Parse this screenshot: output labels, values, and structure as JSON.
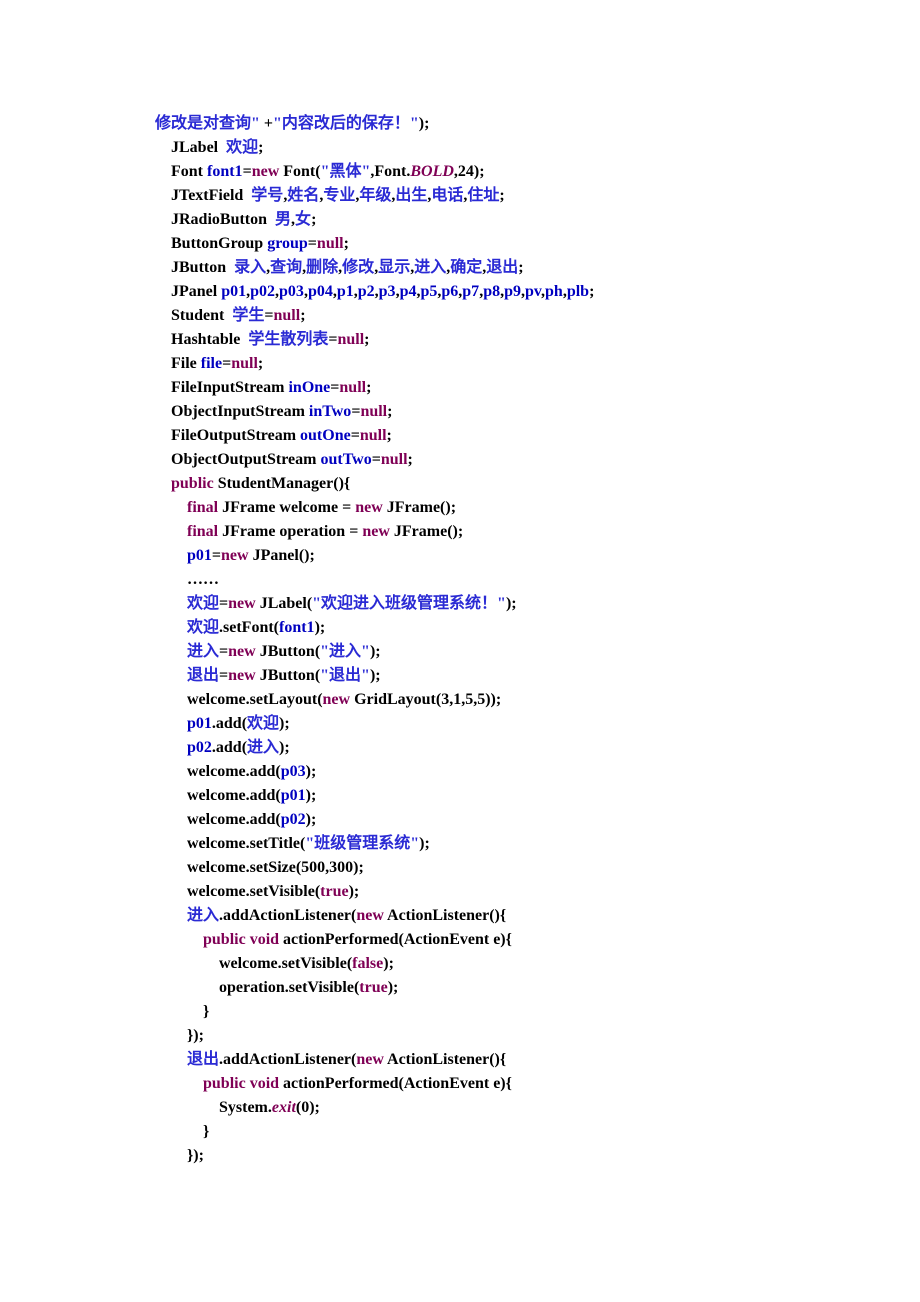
{
  "code": {
    "lines": [
      {
        "indent": 0,
        "parts": [
          {
            "c": "s",
            "t": "修改是对查询\" "
          },
          {
            "c": "t",
            "t": "+"
          },
          {
            "c": "s",
            "t": "\"内容改后的保存！\""
          },
          {
            "c": "t",
            "t": ");"
          }
        ]
      },
      {
        "indent": 1,
        "parts": [
          {
            "c": "t",
            "t": "JLabel  "
          },
          {
            "c": "s",
            "t": "欢迎"
          },
          {
            "c": "t",
            "t": ";"
          }
        ]
      },
      {
        "indent": 1,
        "parts": [
          {
            "c": "t",
            "t": "Font "
          },
          {
            "c": "v",
            "t": "font1"
          },
          {
            "c": "t",
            "t": "="
          },
          {
            "c": "k",
            "t": "new"
          },
          {
            "c": "t",
            "t": " Font("
          },
          {
            "c": "s",
            "t": "\"黑体\""
          },
          {
            "c": "t",
            "t": ",Font."
          },
          {
            "c": "i",
            "t": "BOLD"
          },
          {
            "c": "t",
            "t": ",24);"
          }
        ]
      },
      {
        "indent": 1,
        "parts": [
          {
            "c": "t",
            "t": "JTextField  "
          },
          {
            "c": "s",
            "t": "学号"
          },
          {
            "c": "t",
            "t": ","
          },
          {
            "c": "s",
            "t": "姓名"
          },
          {
            "c": "t",
            "t": ","
          },
          {
            "c": "s",
            "t": "专业"
          },
          {
            "c": "t",
            "t": ","
          },
          {
            "c": "s",
            "t": "年级"
          },
          {
            "c": "t",
            "t": ","
          },
          {
            "c": "s",
            "t": "出生"
          },
          {
            "c": "t",
            "t": ","
          },
          {
            "c": "s",
            "t": "电话"
          },
          {
            "c": "t",
            "t": ","
          },
          {
            "c": "s",
            "t": "住址"
          },
          {
            "c": "t",
            "t": ";"
          }
        ]
      },
      {
        "indent": 1,
        "parts": [
          {
            "c": "t",
            "t": "JRadioButton  "
          },
          {
            "c": "s",
            "t": "男"
          },
          {
            "c": "t",
            "t": ","
          },
          {
            "c": "s",
            "t": "女"
          },
          {
            "c": "t",
            "t": ";"
          }
        ]
      },
      {
        "indent": 1,
        "parts": [
          {
            "c": "t",
            "t": "ButtonGroup "
          },
          {
            "c": "v",
            "t": "group"
          },
          {
            "c": "t",
            "t": "="
          },
          {
            "c": "k",
            "t": "null"
          },
          {
            "c": "t",
            "t": ";"
          }
        ]
      },
      {
        "indent": 1,
        "parts": [
          {
            "c": "t",
            "t": "JButton  "
          },
          {
            "c": "s",
            "t": "录入"
          },
          {
            "c": "t",
            "t": ","
          },
          {
            "c": "s",
            "t": "查询"
          },
          {
            "c": "t",
            "t": ","
          },
          {
            "c": "s",
            "t": "删除"
          },
          {
            "c": "t",
            "t": ","
          },
          {
            "c": "s",
            "t": "修改"
          },
          {
            "c": "t",
            "t": ","
          },
          {
            "c": "s",
            "t": "显示"
          },
          {
            "c": "t",
            "t": ","
          },
          {
            "c": "s",
            "t": "进入"
          },
          {
            "c": "t",
            "t": ","
          },
          {
            "c": "s",
            "t": "确定"
          },
          {
            "c": "t",
            "t": ","
          },
          {
            "c": "s",
            "t": "退出"
          },
          {
            "c": "t",
            "t": ";"
          }
        ]
      },
      {
        "indent": 1,
        "parts": [
          {
            "c": "t",
            "t": "JPanel "
          },
          {
            "c": "v",
            "t": "p01"
          },
          {
            "c": "t",
            "t": ","
          },
          {
            "c": "v",
            "t": "p02"
          },
          {
            "c": "t",
            "t": ","
          },
          {
            "c": "v",
            "t": "p03"
          },
          {
            "c": "t",
            "t": ","
          },
          {
            "c": "v",
            "t": "p04"
          },
          {
            "c": "t",
            "t": ","
          },
          {
            "c": "v",
            "t": "p1"
          },
          {
            "c": "t",
            "t": ","
          },
          {
            "c": "v",
            "t": "p2"
          },
          {
            "c": "t",
            "t": ","
          },
          {
            "c": "v",
            "t": "p3"
          },
          {
            "c": "t",
            "t": ","
          },
          {
            "c": "v",
            "t": "p4"
          },
          {
            "c": "t",
            "t": ","
          },
          {
            "c": "v",
            "t": "p5"
          },
          {
            "c": "t",
            "t": ","
          },
          {
            "c": "v",
            "t": "p6"
          },
          {
            "c": "t",
            "t": ","
          },
          {
            "c": "v",
            "t": "p7"
          },
          {
            "c": "t",
            "t": ","
          },
          {
            "c": "v",
            "t": "p8"
          },
          {
            "c": "t",
            "t": ","
          },
          {
            "c": "v",
            "t": "p9"
          },
          {
            "c": "t",
            "t": ","
          },
          {
            "c": "v",
            "t": "pv"
          },
          {
            "c": "t",
            "t": ","
          },
          {
            "c": "v",
            "t": "ph"
          },
          {
            "c": "t",
            "t": ","
          },
          {
            "c": "v",
            "t": "plb"
          },
          {
            "c": "t",
            "t": ";"
          }
        ]
      },
      {
        "indent": 1,
        "parts": [
          {
            "c": "t",
            "t": "Student  "
          },
          {
            "c": "s",
            "t": "学生"
          },
          {
            "c": "t",
            "t": "="
          },
          {
            "c": "k",
            "t": "null"
          },
          {
            "c": "t",
            "t": ";"
          }
        ]
      },
      {
        "indent": 1,
        "parts": [
          {
            "c": "t",
            "t": "Hashtable  "
          },
          {
            "c": "s",
            "t": "学生散列表"
          },
          {
            "c": "t",
            "t": "="
          },
          {
            "c": "k",
            "t": "null"
          },
          {
            "c": "t",
            "t": ";"
          }
        ]
      },
      {
        "indent": 1,
        "parts": [
          {
            "c": "t",
            "t": "File "
          },
          {
            "c": "v",
            "t": "file"
          },
          {
            "c": "t",
            "t": "="
          },
          {
            "c": "k",
            "t": "null"
          },
          {
            "c": "t",
            "t": ";"
          }
        ]
      },
      {
        "indent": 1,
        "parts": [
          {
            "c": "t",
            "t": "FileInputStream "
          },
          {
            "c": "v",
            "t": "inOne"
          },
          {
            "c": "t",
            "t": "="
          },
          {
            "c": "k",
            "t": "null"
          },
          {
            "c": "t",
            "t": ";"
          }
        ]
      },
      {
        "indent": 1,
        "parts": [
          {
            "c": "t",
            "t": "ObjectInputStream "
          },
          {
            "c": "v",
            "t": "inTwo"
          },
          {
            "c": "t",
            "t": "="
          },
          {
            "c": "k",
            "t": "null"
          },
          {
            "c": "t",
            "t": ";"
          }
        ]
      },
      {
        "indent": 1,
        "parts": [
          {
            "c": "t",
            "t": "FileOutputStream "
          },
          {
            "c": "v",
            "t": "outOne"
          },
          {
            "c": "t",
            "t": "="
          },
          {
            "c": "k",
            "t": "null"
          },
          {
            "c": "t",
            "t": ";"
          }
        ]
      },
      {
        "indent": 1,
        "parts": [
          {
            "c": "t",
            "t": "ObjectOutputStream "
          },
          {
            "c": "v",
            "t": "outTwo"
          },
          {
            "c": "t",
            "t": "="
          },
          {
            "c": "k",
            "t": "null"
          },
          {
            "c": "t",
            "t": ";"
          }
        ]
      },
      {
        "indent": 1,
        "parts": [
          {
            "c": "k",
            "t": "public"
          },
          {
            "c": "t",
            "t": " StudentManager(){"
          }
        ]
      },
      {
        "indent": 2,
        "parts": [
          {
            "c": "k",
            "t": "final"
          },
          {
            "c": "t",
            "t": " JFrame welcome = "
          },
          {
            "c": "k",
            "t": "new"
          },
          {
            "c": "t",
            "t": " JFrame();"
          }
        ]
      },
      {
        "indent": 2,
        "parts": [
          {
            "c": "k",
            "t": "final"
          },
          {
            "c": "t",
            "t": " JFrame operation = "
          },
          {
            "c": "k",
            "t": "new"
          },
          {
            "c": "t",
            "t": " JFrame();"
          }
        ]
      },
      {
        "indent": 2,
        "parts": [
          {
            "c": "v",
            "t": "p01"
          },
          {
            "c": "t",
            "t": "="
          },
          {
            "c": "k",
            "t": "new"
          },
          {
            "c": "t",
            "t": " JPanel();"
          }
        ]
      },
      {
        "indent": 2,
        "parts": [
          {
            "c": "t",
            "t": "……"
          }
        ]
      },
      {
        "indent": 2,
        "parts": [
          {
            "c": "s",
            "t": "欢迎"
          },
          {
            "c": "t",
            "t": "="
          },
          {
            "c": "k",
            "t": "new"
          },
          {
            "c": "t",
            "t": " JLabel("
          },
          {
            "c": "s",
            "t": "\"欢迎进入班级管理系统！\""
          },
          {
            "c": "t",
            "t": ");"
          }
        ]
      },
      {
        "indent": 2,
        "parts": [
          {
            "c": "s",
            "t": "欢迎"
          },
          {
            "c": "t",
            "t": ".setFont("
          },
          {
            "c": "v",
            "t": "font1"
          },
          {
            "c": "t",
            "t": ");"
          }
        ]
      },
      {
        "indent": 2,
        "parts": [
          {
            "c": "s",
            "t": "进入"
          },
          {
            "c": "t",
            "t": "="
          },
          {
            "c": "k",
            "t": "new"
          },
          {
            "c": "t",
            "t": " JButton("
          },
          {
            "c": "s",
            "t": "\"进入\""
          },
          {
            "c": "t",
            "t": ");"
          }
        ]
      },
      {
        "indent": 2,
        "parts": [
          {
            "c": "s",
            "t": "退出"
          },
          {
            "c": "t",
            "t": "="
          },
          {
            "c": "k",
            "t": "new"
          },
          {
            "c": "t",
            "t": " JButton("
          },
          {
            "c": "s",
            "t": "\"退出\""
          },
          {
            "c": "t",
            "t": ");"
          }
        ]
      },
      {
        "indent": 2,
        "parts": [
          {
            "c": "t",
            "t": "welcome.setLayout("
          },
          {
            "c": "k",
            "t": "new"
          },
          {
            "c": "t",
            "t": " GridLayout(3,1,5,5));"
          }
        ]
      },
      {
        "indent": 2,
        "parts": [
          {
            "c": "v",
            "t": "p01"
          },
          {
            "c": "t",
            "t": ".add("
          },
          {
            "c": "s",
            "t": "欢迎"
          },
          {
            "c": "t",
            "t": ");"
          }
        ]
      },
      {
        "indent": 2,
        "parts": [
          {
            "c": "v",
            "t": "p02"
          },
          {
            "c": "t",
            "t": ".add("
          },
          {
            "c": "s",
            "t": "进入"
          },
          {
            "c": "t",
            "t": ");"
          }
        ]
      },
      {
        "indent": 2,
        "parts": [
          {
            "c": "t",
            "t": "welcome.add("
          },
          {
            "c": "v",
            "t": "p03"
          },
          {
            "c": "t",
            "t": ");"
          }
        ]
      },
      {
        "indent": 2,
        "parts": [
          {
            "c": "t",
            "t": "welcome.add("
          },
          {
            "c": "v",
            "t": "p01"
          },
          {
            "c": "t",
            "t": ");"
          }
        ]
      },
      {
        "indent": 2,
        "parts": [
          {
            "c": "t",
            "t": "welcome.add("
          },
          {
            "c": "v",
            "t": "p02"
          },
          {
            "c": "t",
            "t": ");"
          }
        ]
      },
      {
        "indent": 2,
        "parts": [
          {
            "c": "t",
            "t": "welcome.setTitle("
          },
          {
            "c": "s",
            "t": "\"班级管理系统\""
          },
          {
            "c": "t",
            "t": ");"
          }
        ]
      },
      {
        "indent": 2,
        "parts": [
          {
            "c": "t",
            "t": "welcome.setSize(500,300);"
          }
        ]
      },
      {
        "indent": 2,
        "parts": [
          {
            "c": "t",
            "t": "welcome.setVisible("
          },
          {
            "c": "k",
            "t": "true"
          },
          {
            "c": "t",
            "t": ");"
          }
        ]
      },
      {
        "indent": 2,
        "parts": [
          {
            "c": "s",
            "t": "进入"
          },
          {
            "c": "t",
            "t": ".addActionListener("
          },
          {
            "c": "k",
            "t": "new"
          },
          {
            "c": "t",
            "t": " ActionListener(){"
          }
        ]
      },
      {
        "indent": 3,
        "parts": [
          {
            "c": "k",
            "t": "public"
          },
          {
            "c": "t",
            "t": " "
          },
          {
            "c": "k",
            "t": "void"
          },
          {
            "c": "t",
            "t": " actionPerformed(ActionEvent e){"
          }
        ]
      },
      {
        "indent": 4,
        "parts": [
          {
            "c": "t",
            "t": "welcome.setVisible("
          },
          {
            "c": "k",
            "t": "false"
          },
          {
            "c": "t",
            "t": ");"
          }
        ]
      },
      {
        "indent": 4,
        "parts": [
          {
            "c": "t",
            "t": "operation.setVisible("
          },
          {
            "c": "k",
            "t": "true"
          },
          {
            "c": "t",
            "t": ");"
          }
        ]
      },
      {
        "indent": 3,
        "parts": [
          {
            "c": "t",
            "t": "}"
          }
        ]
      },
      {
        "indent": 2,
        "parts": [
          {
            "c": "t",
            "t": "});"
          }
        ]
      },
      {
        "indent": 2,
        "parts": [
          {
            "c": "s",
            "t": "退出"
          },
          {
            "c": "t",
            "t": ".addActionListener("
          },
          {
            "c": "k",
            "t": "new"
          },
          {
            "c": "t",
            "t": " ActionListener(){"
          }
        ]
      },
      {
        "indent": 3,
        "parts": [
          {
            "c": "k",
            "t": "public"
          },
          {
            "c": "t",
            "t": " "
          },
          {
            "c": "k",
            "t": "void"
          },
          {
            "c": "t",
            "t": " actionPerformed(ActionEvent e){"
          }
        ]
      },
      {
        "indent": 4,
        "parts": [
          {
            "c": "t",
            "t": "System."
          },
          {
            "c": "i",
            "t": "exit"
          },
          {
            "c": "t",
            "t": "(0);"
          }
        ]
      },
      {
        "indent": 3,
        "parts": [
          {
            "c": "t",
            "t": "}"
          }
        ]
      },
      {
        "indent": 2,
        "parts": [
          {
            "c": "t",
            "t": "});"
          }
        ]
      }
    ]
  }
}
